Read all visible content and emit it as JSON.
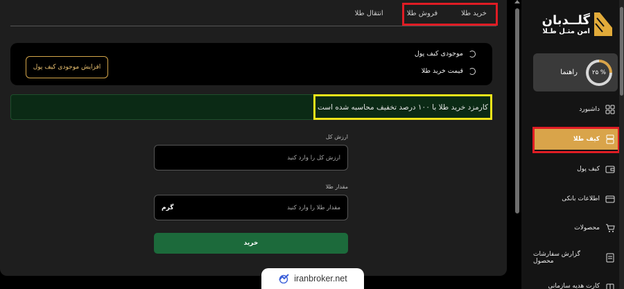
{
  "tabs": [
    {
      "label": "خرید طلا"
    },
    {
      "label": "فروش طلا"
    },
    {
      "label": "انتقال طلا"
    }
  ],
  "wallet": {
    "balance_label": "موجودی کیف پول",
    "price_label": "قیمت خرید طلا",
    "increase_button": "افزایش موجودی کیف پول"
  },
  "fee_notice": "کارمزد خرید طلا با ۱۰۰ درصد تخفیف محاسبه شده است",
  "form": {
    "total_value_label": "ارزش کل",
    "total_value_placeholder": "ارزش کل را وارد کنید",
    "amount_label": "مقدار طلا",
    "amount_placeholder": "مقدار طلا را وارد کنید",
    "amount_unit": "گرم",
    "buy_button": "خرید"
  },
  "sidebar": {
    "logo_title": "گلــدبان",
    "logo_subtitle": "امن مثـل طـلا",
    "guide_label": "راهنما",
    "guide_progress_text": "۲۵ %",
    "guide_progress": 0.25,
    "items": [
      {
        "label": "داشبورد",
        "icon": "dashboard-icon"
      },
      {
        "label": "کیف طلا",
        "icon": "gold-wallet-icon",
        "active": true
      },
      {
        "label": "کیف پول",
        "icon": "wallet-icon"
      },
      {
        "label": "اطلاعات بانکی",
        "icon": "bank-card-icon"
      },
      {
        "label": "محصولات",
        "icon": "cart-icon"
      },
      {
        "label": "گزارش سفارشات محصول",
        "icon": "report-icon"
      },
      {
        "label": "کارت هدیه سازمانی",
        "icon": "gift-card-icon"
      }
    ]
  },
  "watermark": "iranbroker.net",
  "colors": {
    "accent_gold": "#d9a44a",
    "buy_green": "#1c6a3b",
    "highlight_red": "#e01c24",
    "highlight_yellow": "#f0e41a"
  }
}
